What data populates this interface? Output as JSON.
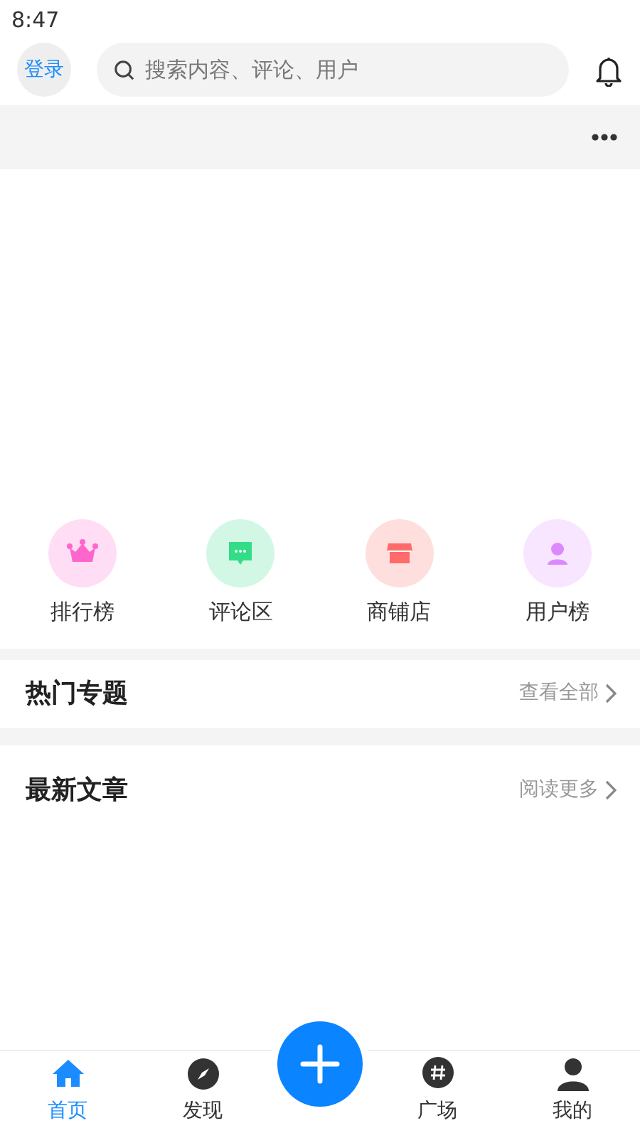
{
  "status_bar": {
    "time": "8:47"
  },
  "header": {
    "login": "登录",
    "search": {
      "placeholder": "搜索内容、评论、用户"
    }
  },
  "shortcuts": [
    {
      "label": "排行榜",
      "color": "#ff66cc"
    },
    {
      "label": "评论区",
      "color": "#33dd88"
    },
    {
      "label": "商铺店",
      "color": "#ff6b6b"
    },
    {
      "label": "用户榜",
      "color": "#dd88ff"
    }
  ],
  "sections": [
    {
      "title": "热门专题",
      "link": "查看全部"
    },
    {
      "title": "最新文章",
      "link": "阅读更多"
    }
  ],
  "bottom_nav": [
    {
      "kind": "tab",
      "label": "首页",
      "selected": true
    },
    {
      "kind": "tab",
      "label": "发现",
      "selected": false
    },
    {
      "kind": "fab"
    },
    {
      "kind": "tab",
      "label": "广场",
      "selected": false
    },
    {
      "kind": "tab",
      "label": "我的",
      "selected": false
    }
  ]
}
